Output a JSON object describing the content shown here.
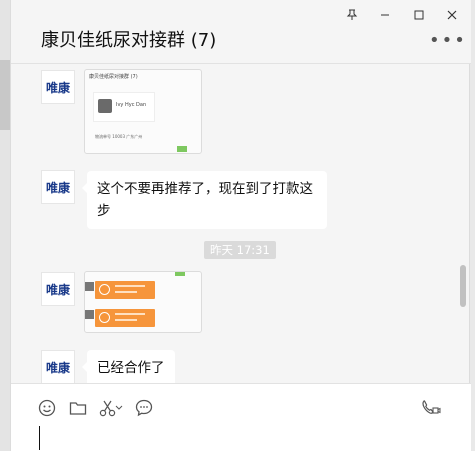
{
  "window": {
    "title": "康贝佳纸尿对接群 (7)",
    "controls": [
      "pin-icon",
      "minimize-icon",
      "maximize-icon",
      "close-icon"
    ],
    "more_label": "•••"
  },
  "messages": [
    {
      "type": "image",
      "sender": "唯康",
      "thumb_title": "康贝佳纸尿对接群 (7)",
      "card_name": "Ivy Hyc Dan",
      "footer_text": "物流单号 10003 广东广州"
    },
    {
      "type": "text",
      "sender": "唯康",
      "lines": [
        "这个不要再推荐了，现在到了打款这",
        "步"
      ]
    },
    {
      "type": "timestamp",
      "text": "昨天 17:31"
    },
    {
      "type": "image",
      "sender": "唯康",
      "description_icons": [
        "orange-card",
        "orange-card"
      ]
    },
    {
      "type": "text",
      "sender": "唯康",
      "lines": [
        "已经合作了"
      ]
    }
  ],
  "toolbar": {
    "icons": [
      "emoji-icon",
      "folder-icon",
      "scissors-icon",
      "chat-bubble-icon",
      "video-call-icon"
    ]
  },
  "colors": {
    "window_bg": "#f5f5f5",
    "bubble_bg": "#ffffff",
    "avatar_text": "#1a3a8a",
    "orange": "#f6953b",
    "green": "#7ec860"
  }
}
